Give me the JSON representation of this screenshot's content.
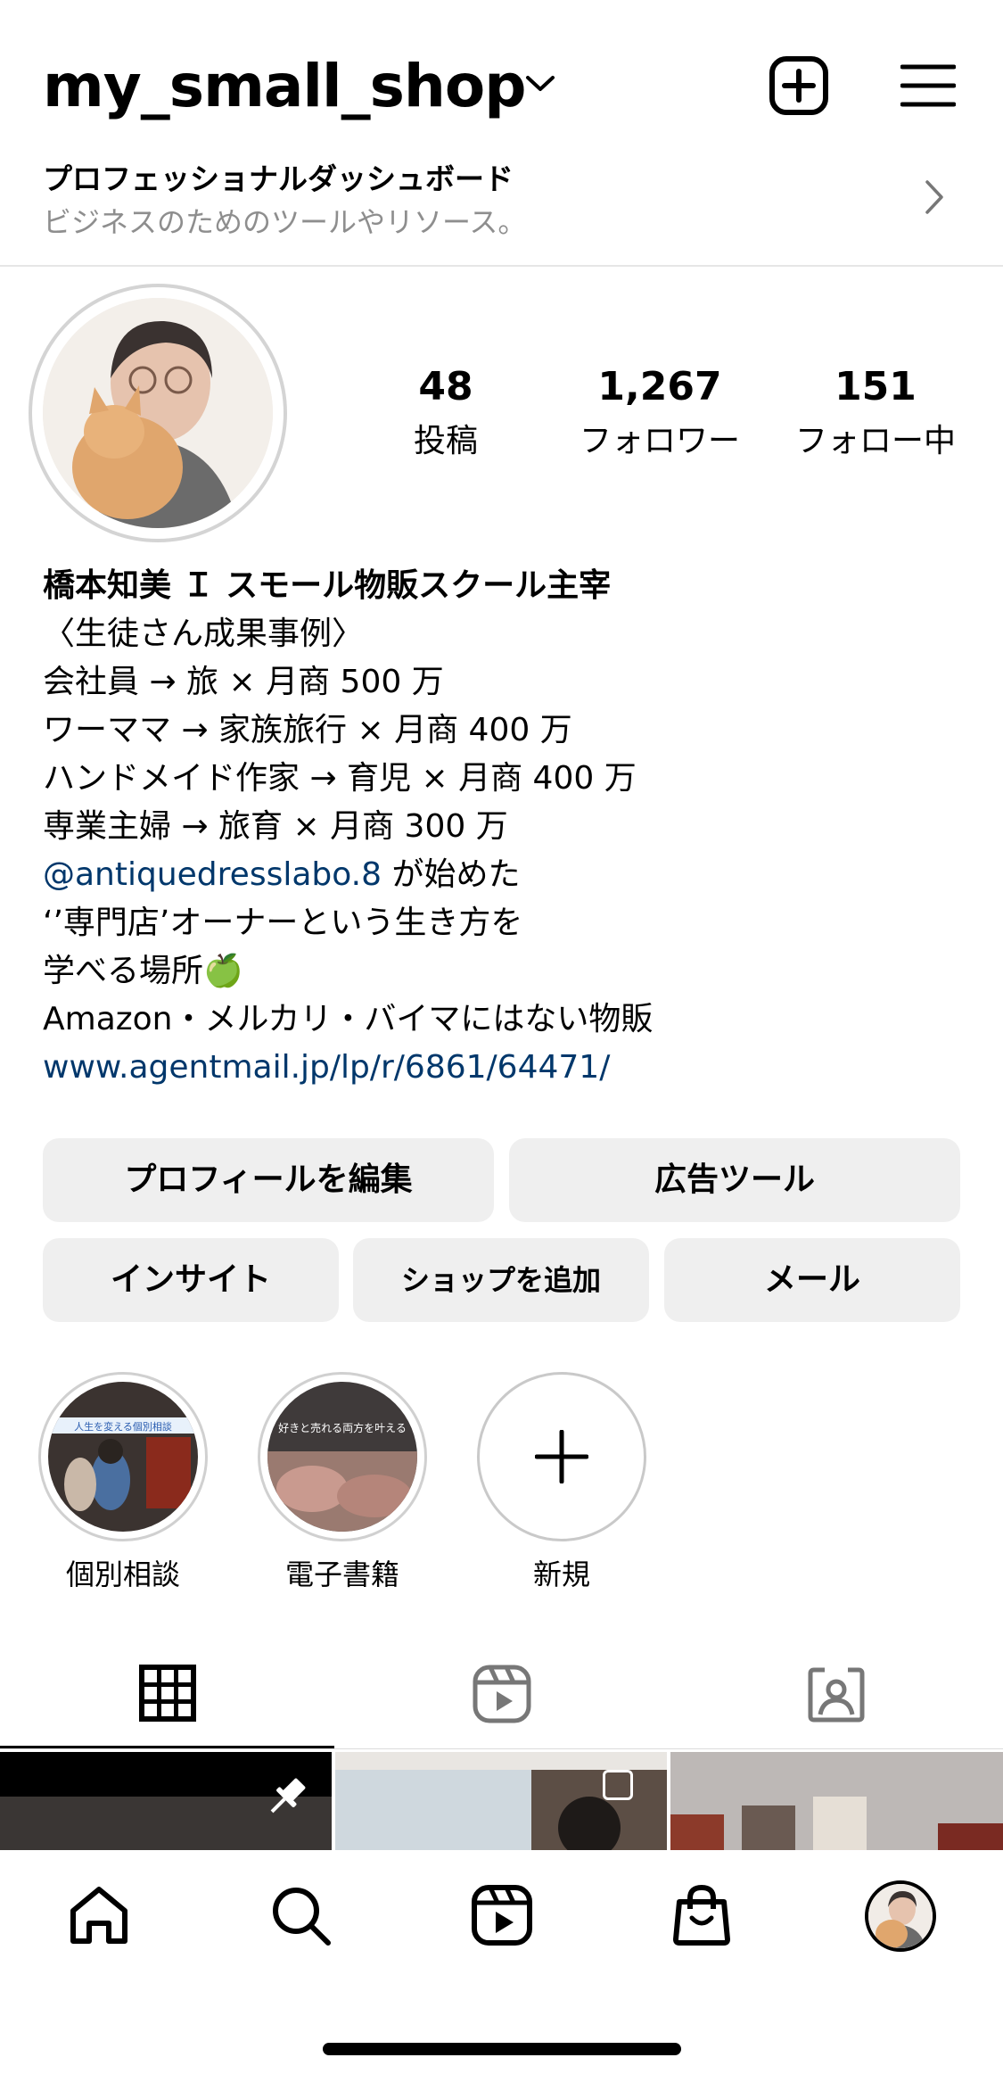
{
  "header": {
    "username": "my_small_shop",
    "dashboard_title": "プロフェッショナルダッシュボード",
    "dashboard_subtitle": "ビジネスのためのツールやリソース。"
  },
  "stats": [
    {
      "value": "48",
      "label": "投稿"
    },
    {
      "value": "1,267",
      "label": "フォロワー"
    },
    {
      "value": "151",
      "label": "フォロー中"
    }
  ],
  "bio": {
    "name": "橋本知美 Ｉ スモール物販スクール主宰",
    "lines": [
      "〈生徒さん成果事例〉",
      "会社員 → 旅 × 月商 500 万",
      "ワーママ → 家族旅行 × 月商 400 万",
      "ハンドメイド作家 → 育児 × 月商 400 万",
      "専業主婦 → 旅育 × 月商 300 万"
    ],
    "mention": "@antiquedresslabo.8",
    "mention_suffix": " が始めた",
    "line_quote": "‘’専門店’オーナーという生き方を",
    "line_learn": "学べる場所",
    "line_learn_emoji": "🍏",
    "line_amazon": "Amazon・メルカリ・バイマにはない物販",
    "website": "www.agentmail.jp/lp/r/6861/64471/"
  },
  "buttons": {
    "edit_profile": "プロフィールを編集",
    "ad_tools": "広告ツール",
    "insights": "インサイト",
    "add_shop": "ショップを追加",
    "email": "メール"
  },
  "highlights": [
    {
      "label": "個別相談",
      "thumb_caption": "人生を変える個別相談"
    },
    {
      "label": "電子書籍",
      "thumb_caption": "好きと売れる両方を叶える"
    },
    {
      "label": "新規"
    }
  ],
  "tabs": {
    "active": "grid",
    "items": [
      "grid-icon",
      "reels-icon",
      "tagged-icon"
    ]
  },
  "bottom_nav": {
    "items": [
      "home-icon",
      "search-icon",
      "reels-icon",
      "shop-icon",
      "profile-avatar"
    ]
  },
  "colors": {
    "link": "#00376b",
    "button_bg": "#efefef",
    "secondary_text": "#8e8e8e"
  }
}
